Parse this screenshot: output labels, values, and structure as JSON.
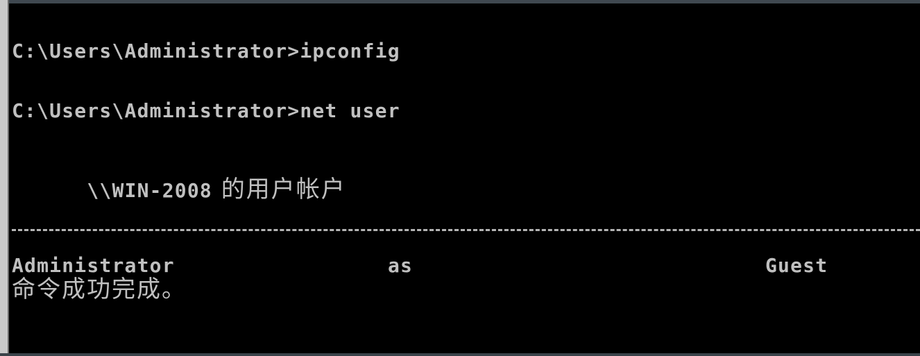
{
  "console": {
    "partial_top_line": "           ",
    "line1": "C:\\Users\\Administrator>ipconfig",
    "line2": "C:\\Users\\Administrator>net user",
    "line3_host": "\\\\WIN-2008",
    "line3_suffix": " 的用户帐户",
    "users": [
      "Administrator",
      "as",
      "Guest"
    ],
    "result": "命令成功完成。"
  },
  "colors": {
    "background": "#000000",
    "text": "#c0c0c0"
  }
}
